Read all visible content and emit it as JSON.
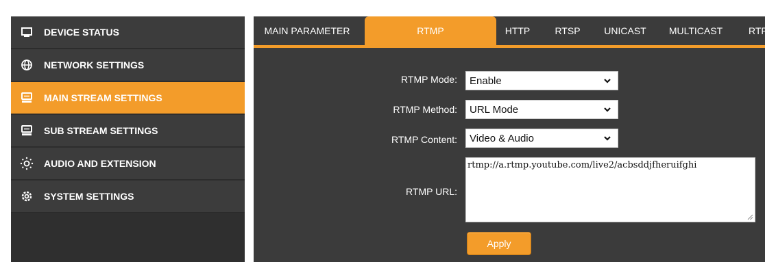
{
  "sidebar": {
    "items": [
      {
        "label": "DEVICE STATUS",
        "icon": "monitor-icon"
      },
      {
        "label": "NETWORK SETTINGS",
        "icon": "globe-icon"
      },
      {
        "label": "MAIN STREAM SETTINGS",
        "icon": "hard-drive-icon",
        "active": true
      },
      {
        "label": "SUB STREAM SETTINGS",
        "icon": "hard-drive-icon"
      },
      {
        "label": "AUDIO AND EXTENSION",
        "icon": "sun-dots-icon"
      },
      {
        "label": "SYSTEM SETTINGS",
        "icon": "gear-icon"
      }
    ]
  },
  "tabs": [
    {
      "label": "MAIN PARAMETER"
    },
    {
      "label": "RTMP",
      "active": true
    },
    {
      "label": "HTTP"
    },
    {
      "label": "RTSP"
    },
    {
      "label": "UNICAST"
    },
    {
      "label": "MULTICAST"
    },
    {
      "label": "RTP"
    }
  ],
  "form": {
    "rtmp_mode": {
      "label": "RTMP Mode:",
      "value": "Enable"
    },
    "rtmp_method": {
      "label": "RTMP Method:",
      "value": "URL Mode"
    },
    "rtmp_content": {
      "label": "RTMP Content:",
      "value": "Video & Audio"
    },
    "rtmp_url": {
      "label": "RTMP URL:",
      "value": "rtmp://a.rtmp.youtube.com/live2/acbsddjfheruifghi"
    },
    "apply_label": "Apply"
  },
  "colors": {
    "accent": "#f39c2a",
    "panel": "#3b3b3b",
    "sidebar": "#3c3c3c"
  }
}
